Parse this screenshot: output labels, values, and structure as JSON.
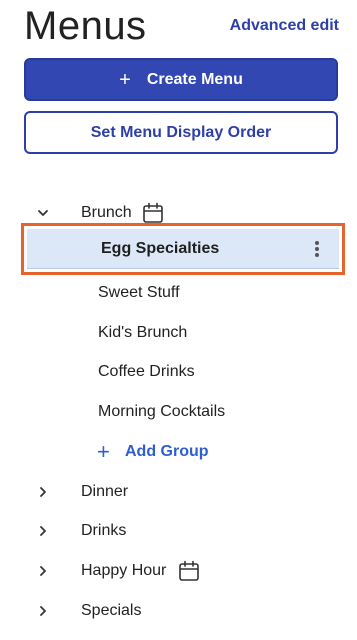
{
  "header": {
    "title": "Menus",
    "advanced_edit": "Advanced edit"
  },
  "actions": {
    "create_menu_icon": "+",
    "create_menu": "Create Menu",
    "set_display_order": "Set Menu Display Order"
  },
  "menus": [
    {
      "name": "Brunch",
      "expanded": true,
      "scheduled": true,
      "groups": [
        {
          "name": "Egg Specialties",
          "selected": true
        },
        {
          "name": "Sweet Stuff"
        },
        {
          "name": "Kid's Brunch"
        },
        {
          "name": "Coffee Drinks"
        },
        {
          "name": "Morning Cocktails"
        }
      ],
      "add_group_icon": "+",
      "add_group": "Add Group"
    },
    {
      "name": "Dinner",
      "expanded": false,
      "scheduled": false
    },
    {
      "name": "Drinks",
      "expanded": false,
      "scheduled": false
    },
    {
      "name": "Happy Hour",
      "expanded": false,
      "scheduled": true
    },
    {
      "name": "Specials",
      "expanded": false,
      "scheduled": false
    }
  ],
  "colors": {
    "primary": "#3347b3",
    "link": "#2e3fa8",
    "selection_bg": "#dce8f7",
    "highlight_border": "#e8622c"
  }
}
